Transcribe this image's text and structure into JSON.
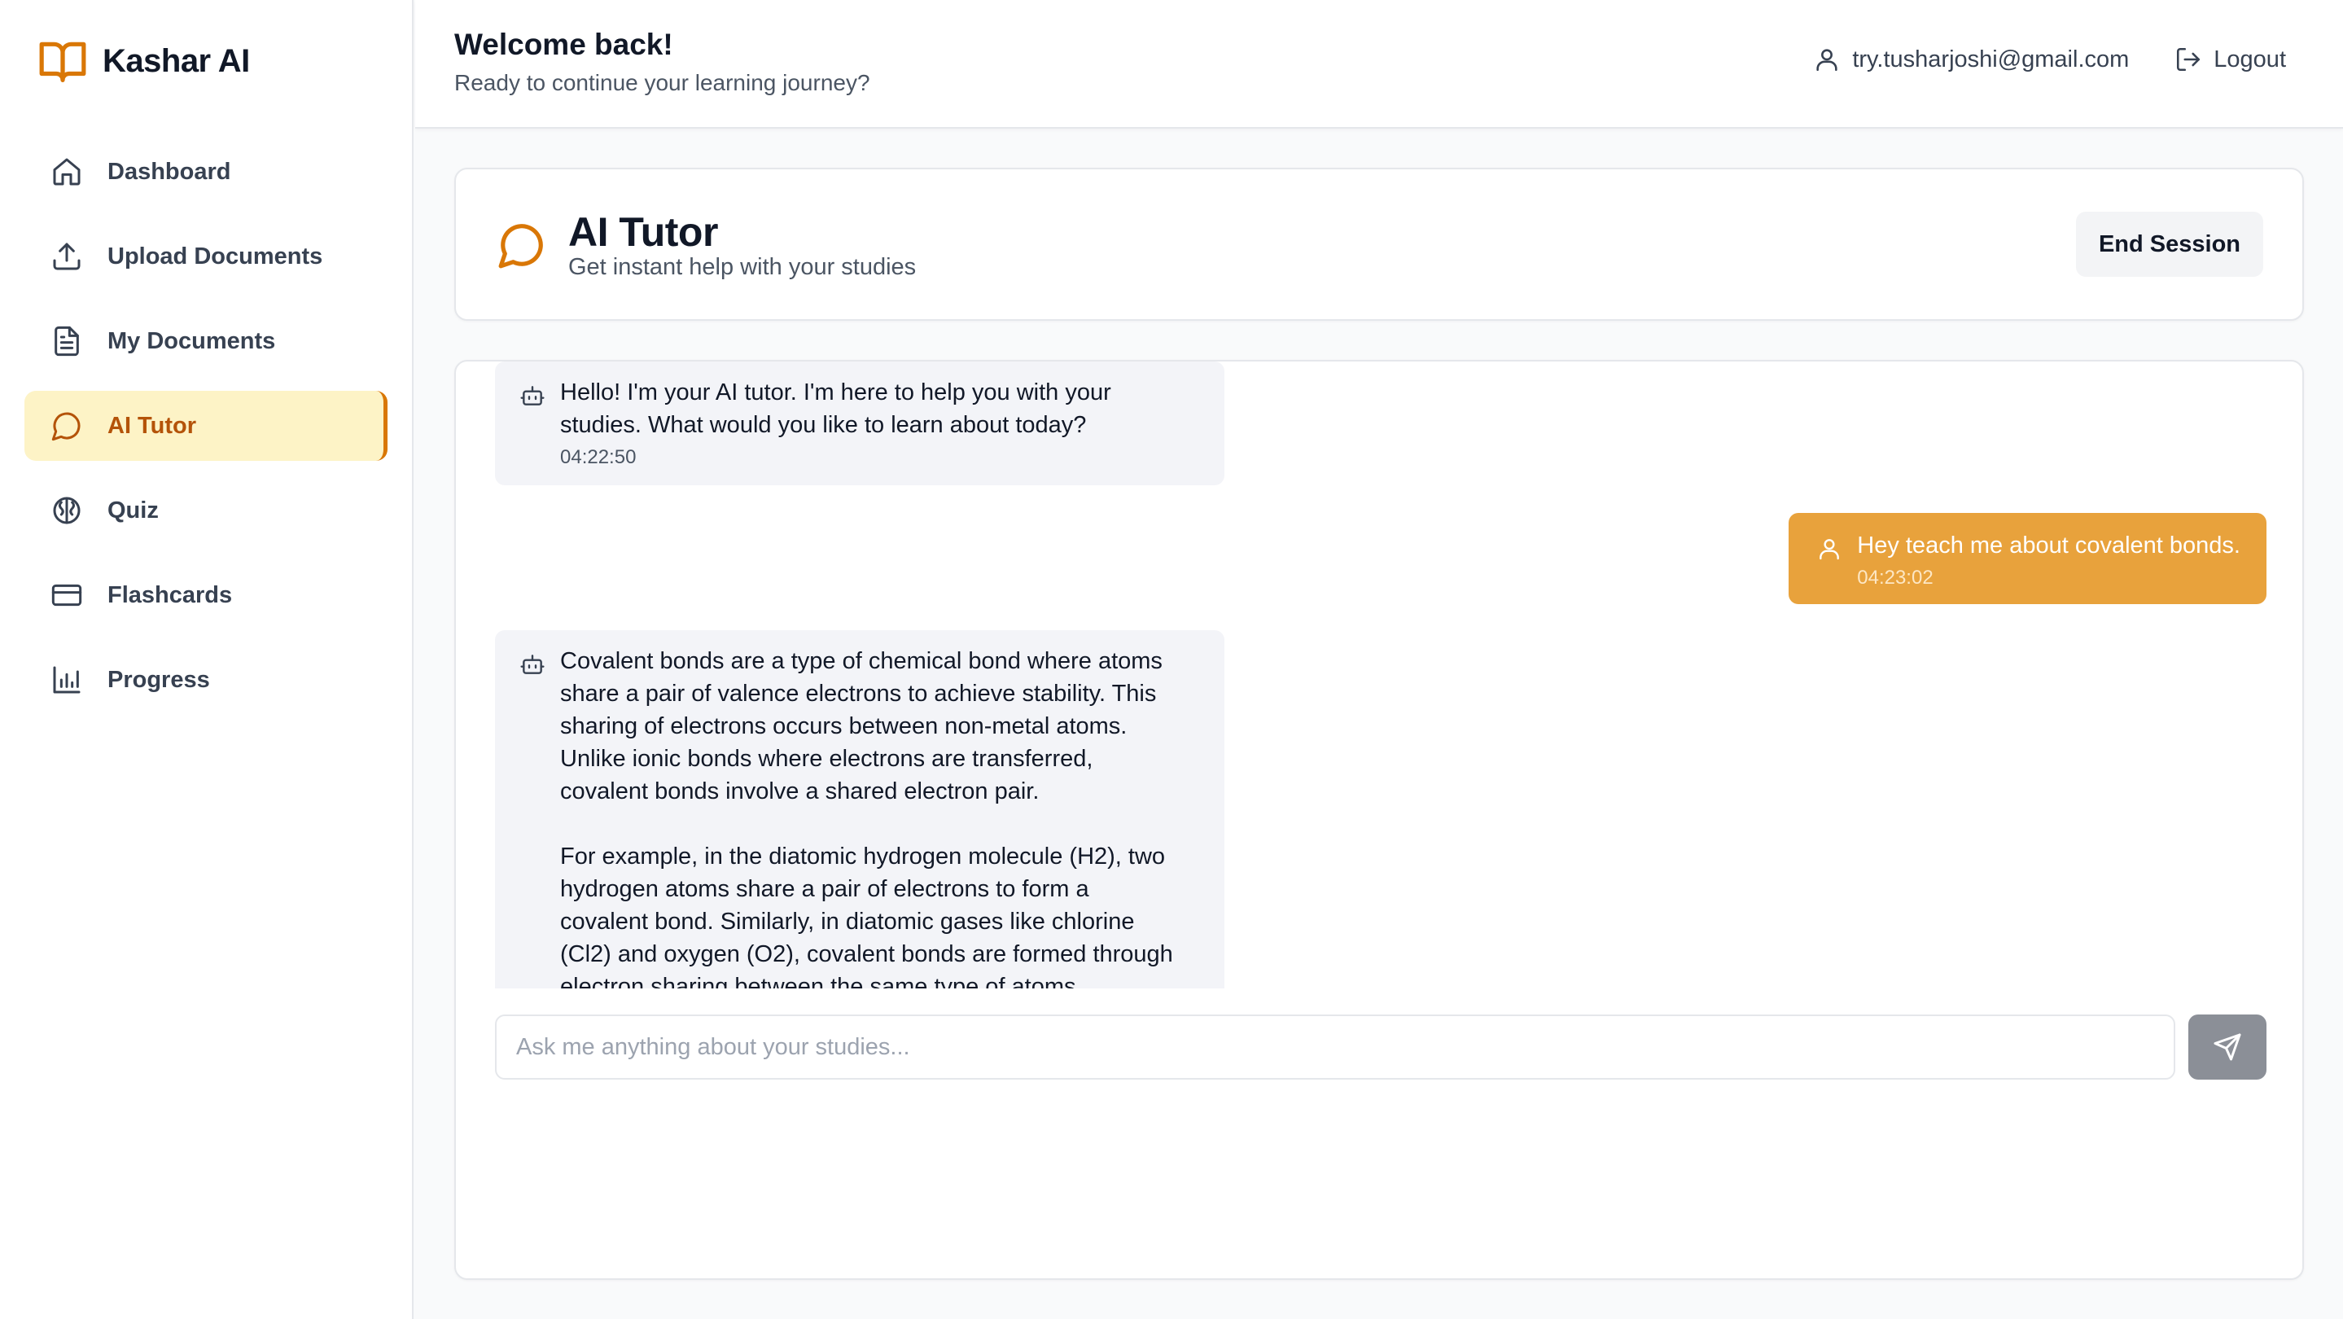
{
  "app": {
    "name": "Kashar AI",
    "brand_color": "#d97706"
  },
  "sidebar": {
    "items": [
      {
        "label": "Dashboard",
        "icon": "home-icon",
        "active": false
      },
      {
        "label": "Upload Documents",
        "icon": "upload-icon",
        "active": false
      },
      {
        "label": "My Documents",
        "icon": "document-icon",
        "active": false
      },
      {
        "label": "AI Tutor",
        "icon": "chat-bubble-icon",
        "active": true
      },
      {
        "label": "Quiz",
        "icon": "brain-icon",
        "active": false
      },
      {
        "label": "Flashcards",
        "icon": "card-icon",
        "active": false
      },
      {
        "label": "Progress",
        "icon": "bar-chart-icon",
        "active": false
      }
    ]
  },
  "header": {
    "title": "Welcome back!",
    "subtitle": "Ready to continue your learning journey?",
    "user_email": "try.tusharjoshi@gmail.com",
    "logout_label": "Logout"
  },
  "tutor": {
    "title": "AI Tutor",
    "subtitle": "Get instant help with your studies",
    "end_session_label": "End Session"
  },
  "messages": [
    {
      "role": "bot",
      "text": "Hello! I'm your AI tutor. I'm here to help you with your\nstudies. What would you like to learn about today?",
      "time": "04:22:50"
    },
    {
      "role": "user",
      "text": "Hey teach me about covalent bonds.",
      "time": "04:23:02"
    },
    {
      "role": "bot",
      "text": "Covalent bonds are a type of chemical bond where atoms\nshare a pair of valence electrons to achieve stability. This\nsharing of electrons occurs between non-metal atoms.\nUnlike ionic bonds where electrons are transferred,\ncovalent bonds involve a shared electron pair.\n\nFor example, in the diatomic hydrogen molecule (H2), two\nhydrogen atoms share a pair of electrons to form a\ncovalent bond. Similarly, in diatomic gases like chlorine\n(Cl2) and oxygen (O2), covalent bonds are formed through\nelectron sharing between the same type of atoms.",
      "time": ""
    }
  ],
  "composer": {
    "placeholder": "Ask me anything about your studies...",
    "value": ""
  },
  "colors": {
    "accent": "#d97706",
    "active_bg": "#fdf3c6",
    "user_bubble": "#e8a23c",
    "bot_bubble": "#f3f4f8",
    "send_button": "#8b8f97"
  }
}
